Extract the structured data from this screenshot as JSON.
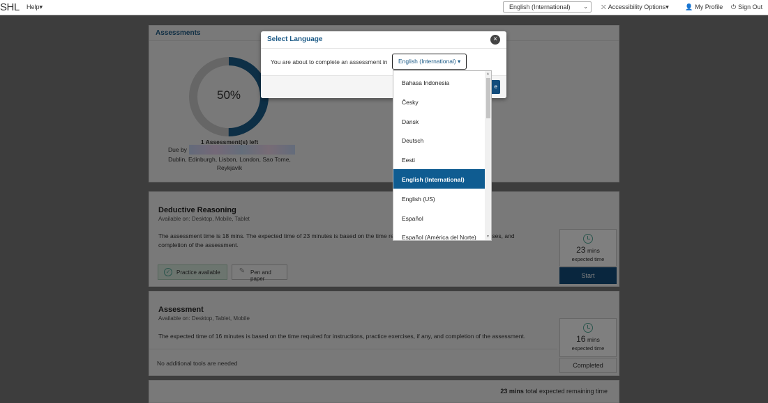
{
  "nav": {
    "logo": "SHL",
    "help": "Help",
    "language_value": "English (International)",
    "accessibility": "Accessibility Options",
    "profile": "My Profile",
    "signout": "Sign Out"
  },
  "assessments_panel": {
    "title": "Assessments",
    "progress_percent": 50,
    "progress_label": "50%",
    "remaining_label": "1 Assessment(s) left",
    "due_by_label": "Due by",
    "timezone": "Dublin, Edinburgh, Lisbon, London, Sao Tome, Reykjavik"
  },
  "cards": [
    {
      "title": "Deductive Reasoning",
      "available": "Available on:   Desktop, Mobile, Tablet",
      "description": "The assessment time is 18 mins. The expected time of 23 minutes is based on the time required for instructions, practice exercises, and completion of the assessment.",
      "tools": [
        "Practice available",
        "Pen and paper"
      ],
      "mins": "23",
      "mins_unit": "mins",
      "expected_label": "expected time",
      "action": "Start"
    },
    {
      "title": "Assessment",
      "available": "Available on:   Desktop, Tablet, Mobile",
      "description": "The expected time of 16 minutes is based on the time required for instructions, practice exercises, if any, and completion of the assessment.",
      "tools_note": "No additional tools are needed",
      "mins": "16",
      "mins_unit": "mins",
      "expected_label": "expected time",
      "action": "Completed"
    }
  ],
  "total": {
    "mins": "23 mins",
    "label": "total expected remaining time"
  },
  "modal": {
    "title": "Select Language",
    "close": "×",
    "text": "You are about to complete an assessment in",
    "selected": "English (International)",
    "continue_label": "e"
  },
  "languages": [
    "Bahasa Indonesia",
    "Česky",
    "Dansk",
    "Deutsch",
    "Eesti",
    "English (International)",
    "English (US)",
    "Español",
    "Español (América del Norte)"
  ],
  "selected_language_index": 5,
  "colors": {
    "accent": "#124c7c",
    "selected": "#0f5c91",
    "ring_track": "#cccccc",
    "ring_fill": "#1b5e8c"
  }
}
